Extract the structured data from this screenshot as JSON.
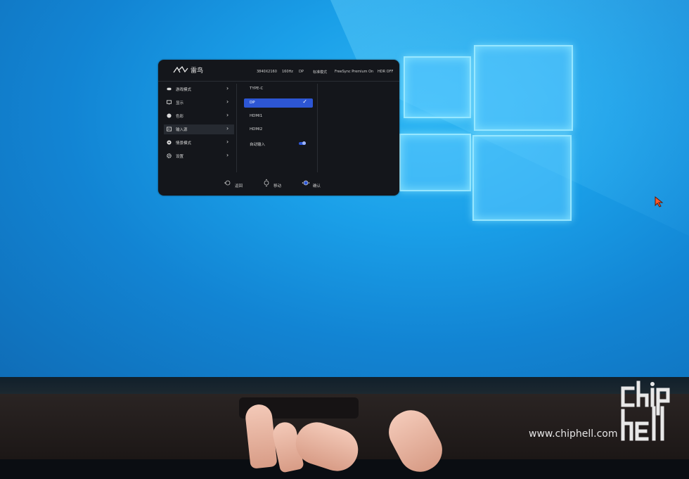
{
  "osd": {
    "brand": "雷鸟",
    "status": {
      "resolution": "3840X2160",
      "refresh": "160Hz",
      "input": "DP",
      "mode": "标准模式",
      "freesync": "FreeSync Premium On",
      "hdr": "HDR OFF"
    },
    "menu": [
      {
        "label": "游戏模式",
        "icon": "gamepad-icon"
      },
      {
        "label": "显示",
        "icon": "monitor-icon"
      },
      {
        "label": "色彩",
        "icon": "palette-icon"
      },
      {
        "label": "输入源",
        "icon": "input-source-icon",
        "active": true
      },
      {
        "label": "情景模式",
        "icon": "scene-mode-icon"
      },
      {
        "label": "设置",
        "icon": "settings-gear-icon"
      }
    ],
    "options": [
      {
        "label": "TYPE-C"
      },
      {
        "label": "DP",
        "selected": true
      },
      {
        "label": "HDMI1"
      },
      {
        "label": "HDMI2"
      },
      {
        "label": "自动输入",
        "toggle": "on"
      }
    ],
    "footer": {
      "back": "返回",
      "move": "移动",
      "confirm": "确认"
    },
    "colors": {
      "panel": "#14161b",
      "accent": "#2d56d4"
    }
  },
  "watermark": {
    "url": "www.chiphell.com",
    "logo": "chip hell"
  }
}
